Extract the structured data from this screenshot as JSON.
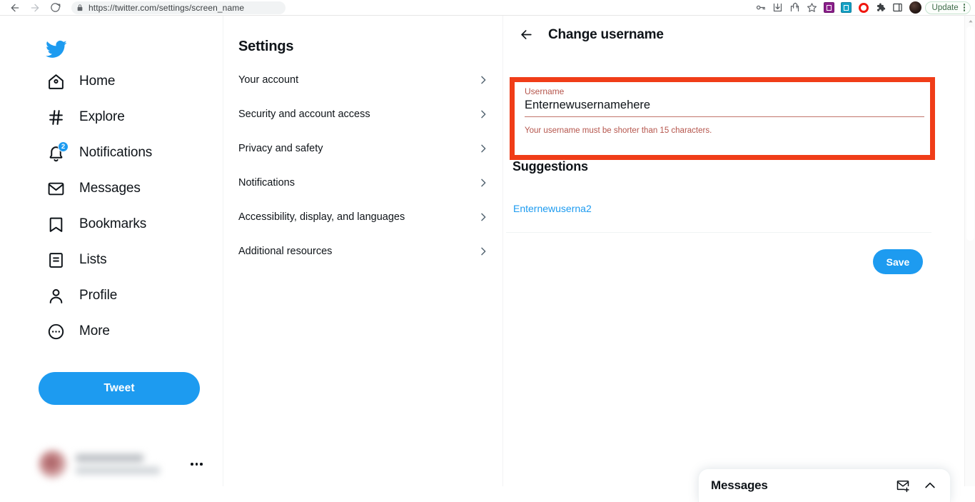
{
  "browser": {
    "url": "https://twitter.com/settings/screen_name",
    "nav": {
      "back": "back-arrow",
      "forward": "forward-arrow",
      "reload": "reload"
    },
    "lock_icon": "lock-icon",
    "toolbar_icons": [
      "password-key-icon",
      "download-icon",
      "share-icon",
      "bookmark-star-icon",
      "extension-purple-icon",
      "extension-teal-icon",
      "extension-red-circle-icon",
      "puzzle-extensions-icon",
      "side-panel-icon"
    ],
    "avatar": "profile-avatar",
    "update_label": "Update",
    "menu_icon": "kebab-menu-icon"
  },
  "sidebar": {
    "logo": "twitter-bird-logo",
    "items": [
      {
        "label": "Home",
        "icon": "home-icon",
        "badge": ""
      },
      {
        "label": "Explore",
        "icon": "hashtag-icon",
        "badge": ""
      },
      {
        "label": "Notifications",
        "icon": "bell-icon",
        "badge": "2"
      },
      {
        "label": "Messages",
        "icon": "envelope-icon",
        "badge": ""
      },
      {
        "label": "Bookmarks",
        "icon": "bookmark-icon",
        "badge": ""
      },
      {
        "label": "Lists",
        "icon": "list-icon",
        "badge": ""
      },
      {
        "label": "Profile",
        "icon": "person-icon",
        "badge": ""
      },
      {
        "label": "More",
        "icon": "more-circle-icon",
        "badge": ""
      }
    ],
    "tweet_button": "Tweet",
    "account_menu_icon": "account-more-icon"
  },
  "settings": {
    "title": "Settings",
    "items": [
      {
        "label": "Your account"
      },
      {
        "label": "Security and account access"
      },
      {
        "label": "Privacy and safety"
      },
      {
        "label": "Notifications"
      },
      {
        "label": "Accessibility, display, and languages"
      },
      {
        "label": "Additional resources"
      }
    ],
    "chevron_icon": "chevron-right-icon"
  },
  "detail": {
    "back_icon": "back-arrow-icon",
    "title": "Change username",
    "field": {
      "label": "Username",
      "value": "Enternewusernamehere",
      "placeholder": "Username",
      "error": "Your username must be shorter than 15 characters."
    },
    "suggestions_title": "Suggestions",
    "suggestions": [
      {
        "label": "Enternewuserna2"
      }
    ],
    "save_button": "Save"
  },
  "messages_dock": {
    "title": "Messages",
    "new_message_icon": "new-message-icon",
    "expand_icon": "chevron-up-icon"
  },
  "colors": {
    "twitter_blue": "#1d9bf0",
    "annotation_red": "#f03d18",
    "error_text": "#b5554c",
    "text_primary": "#0f1419",
    "text_secondary": "#536471"
  }
}
